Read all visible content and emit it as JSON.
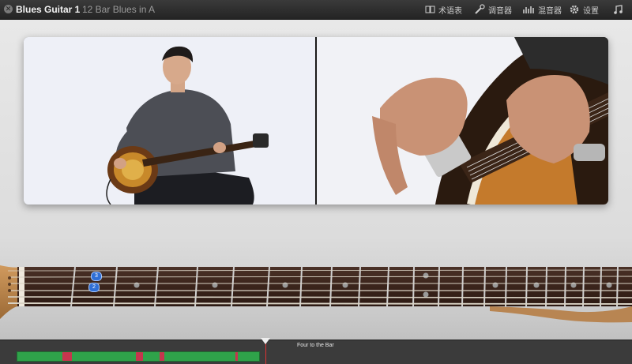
{
  "window": {
    "title": "Blues Guitar 1",
    "subtitle": "12 Bar Blues in A"
  },
  "toolbar": {
    "items": [
      {
        "label": "术语表",
        "icon": "glossary-icon"
      },
      {
        "label": "调音器",
        "icon": "tuner-icon"
      },
      {
        "label": "混音器",
        "icon": "mixer-icon"
      },
      {
        "label": "设置",
        "icon": "gear-icon"
      },
      {
        "label": "",
        "icon": "music-note-icon"
      }
    ]
  },
  "video": {
    "left_panel": "guitarist-wide-shot",
    "right_panel": "guitar-closeup"
  },
  "fretboard": {
    "finger_markers": [
      "3",
      "2"
    ]
  },
  "timeline": {
    "section_label": "Four to the Bar"
  },
  "colors": {
    "topbar": "#2e2e2e",
    "track": "#2fa34a",
    "track_marker": "#c6354e",
    "playhead": "#dd3333",
    "finger_marker": "#2f6fd6"
  }
}
